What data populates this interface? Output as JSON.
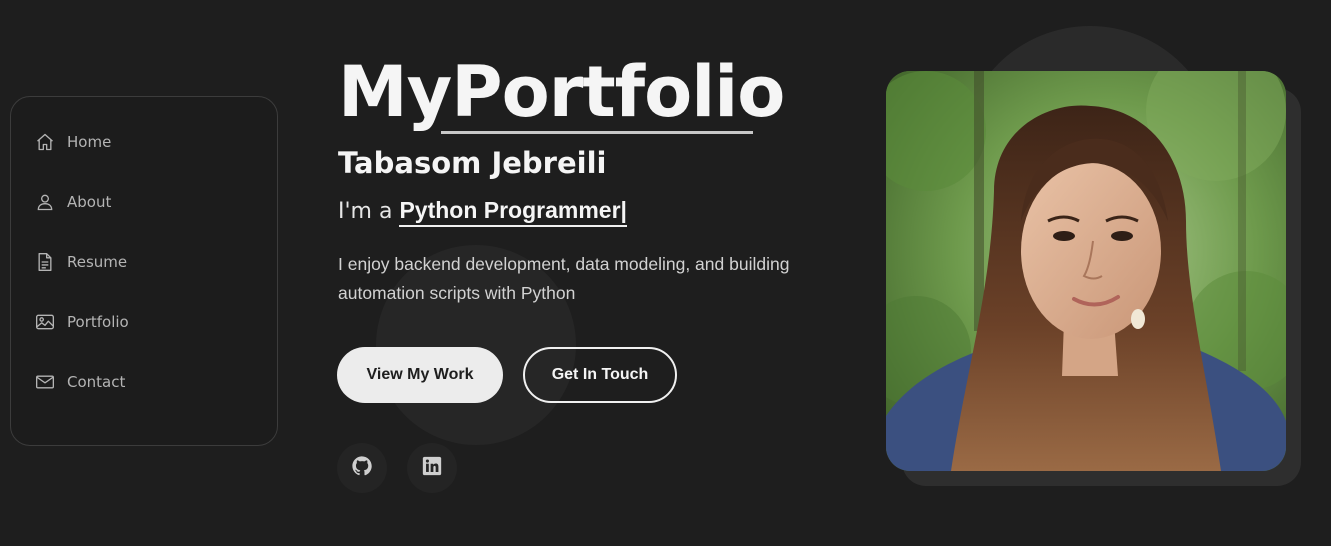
{
  "sidebar": {
    "items": [
      {
        "label": "Home",
        "icon": "home-icon"
      },
      {
        "label": "About",
        "icon": "user-icon"
      },
      {
        "label": "Resume",
        "icon": "document-icon"
      },
      {
        "label": "Portfolio",
        "icon": "image-icon"
      },
      {
        "label": "Contact",
        "icon": "envelope-icon"
      }
    ]
  },
  "hero": {
    "brand_prefix": "My",
    "brand_suffix": "Portfolio",
    "name": "Tabasom Jebreili",
    "role_prefix": "I'm a ",
    "role": "Python Programmer|",
    "description": "I enjoy backend development, data modeling, and building automation scripts with Python",
    "primary_button": "View My Work",
    "secondary_button": "Get In Touch",
    "social": [
      {
        "icon": "github-icon"
      },
      {
        "icon": "linkedin-icon"
      }
    ]
  },
  "colors": {
    "background": "#1e1e1e",
    "text": "#f5f5f5",
    "muted": "#b4b4b4",
    "button_primary": "#ececec"
  }
}
